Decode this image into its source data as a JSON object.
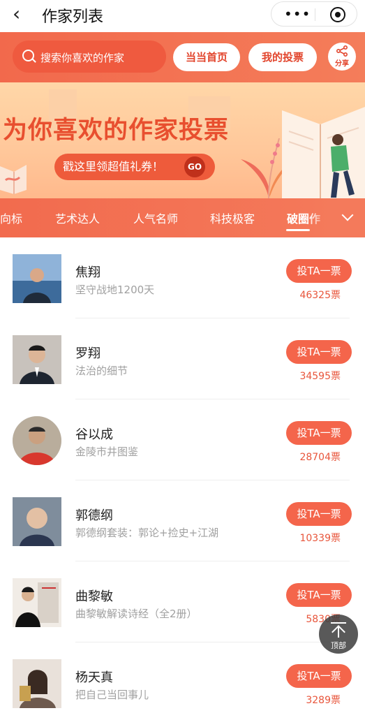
{
  "nav": {
    "back_icon": "chevron-left-icon",
    "title": "作家列表",
    "more_icon": "more-dots-icon",
    "close_icon": "target-circle-icon"
  },
  "header": {
    "search_placeholder": "搜索你喜欢的作家",
    "home_label": "当当首页",
    "my_votes_label": "我的投票",
    "share_label": "分享",
    "colors": {
      "brand": "#f26b4e",
      "brand_text": "#e2452d"
    }
  },
  "banner": {
    "title": "为你喜欢的作家投票",
    "coupon_label": "戳这里领超值礼券！",
    "go_label": "GO"
  },
  "tabs": {
    "items": [
      "风向标",
      "艺术达人",
      "人气名师",
      "科技极客",
      "破圈作"
    ],
    "active_index": 4,
    "expand_icon": "chevron-down-icon"
  },
  "authors": [
    {
      "name": "焦翔",
      "book": "坚守战地1200天",
      "vote_label": "投TA一票",
      "votes": "46325票"
    },
    {
      "name": "罗翔",
      "book": "法治的细节",
      "vote_label": "投TA一票",
      "votes": "34595票"
    },
    {
      "name": "谷以成",
      "book": "金陵市井图鉴",
      "vote_label": "投TA一票",
      "votes": "28704票"
    },
    {
      "name": "郭德纲",
      "book": "郭德纲套装：郭论+捡史+江湖",
      "vote_label": "投TA一票",
      "votes": "10339票"
    },
    {
      "name": "曲黎敏",
      "book": "曲黎敏解读诗经（全2册）",
      "vote_label": "投TA一票",
      "votes": "5830票"
    },
    {
      "name": "杨天真",
      "book": "把自己当回事儿",
      "vote_label": "投TA一票",
      "votes": "3289票"
    }
  ],
  "back_to_top": {
    "label": "顶部",
    "icon": "arrow-up-icon"
  }
}
